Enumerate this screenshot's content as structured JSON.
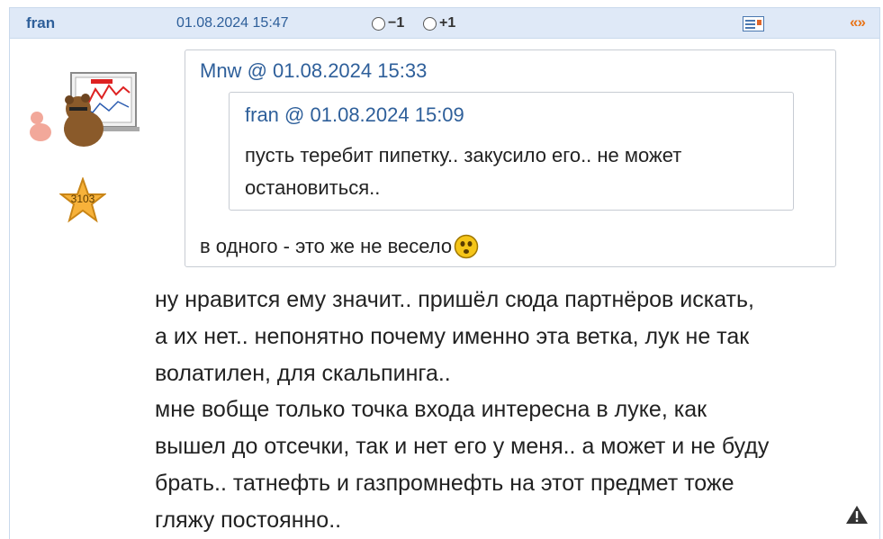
{
  "post": {
    "author": "fran",
    "date": "01.08.2024 15:47",
    "vote_minus": "−1",
    "vote_plus": "+1",
    "quote_link": "«»",
    "rating": "3103"
  },
  "quote_outer": {
    "author": "Mnw",
    "date": "01.08.2024 15:33",
    "text": "в одного - это же не весело"
  },
  "quote_inner": {
    "author": "fran",
    "date": "01.08.2024 15:09",
    "text": "пусть теребит пипетку.. закусило его.. не может остановиться.."
  },
  "body": {
    "line1": "ну нравится ему значит.. пришёл сюда партнёров искать,",
    "line2": "а их нет.. непонятно почему именно эта ветка, лук не так",
    "line3": "волатилен, для скальпинга..",
    "line4": "мне вобще только точка входа интересна в луке, как",
    "line5": "вышел до отсечки, так и нет его у меня.. а может и не буду",
    "line6": "брать.. татнефть и газпромнефть на этот предмет тоже",
    "line7": "гляжу постоянно.."
  },
  "icons": {
    "message": "message-icon",
    "smiley": "smiley-icon",
    "warning": "warning-icon",
    "star": "star-icon"
  },
  "colors": {
    "header_bg": "#dfe9f7",
    "link": "#2e5f9a",
    "quote_link": "#e8751a"
  }
}
